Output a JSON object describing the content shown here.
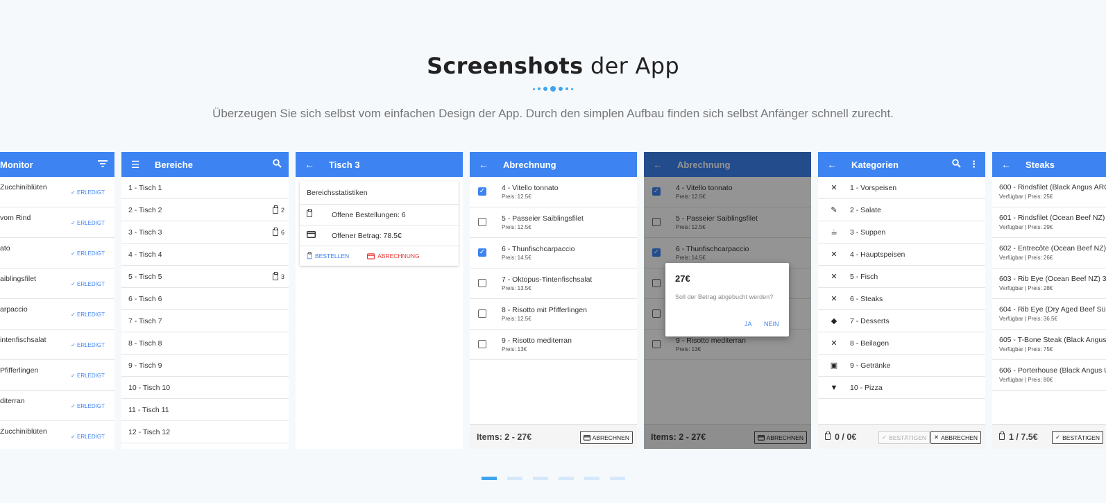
{
  "header": {
    "title_bold": "Screenshots",
    "title_light": " der App",
    "subtitle": "Überzeugen Sie sich selbst vom einfachen Design der App. Durch den simplen Aufbau finden sich selbst Anfänger schnell zurecht."
  },
  "colors": {
    "accent": "#3d84f2",
    "brand_blue": "#3fa5f0",
    "danger": "#e53935"
  },
  "screens": {
    "monitor": {
      "title": "Monitor",
      "action_icon": "filter-icon",
      "items": [
        {
          "name": "Zucchiniblüten",
          "status": "ERLEDIGT"
        },
        {
          "name": "vom Rind",
          "status": "ERLEDIGT"
        },
        {
          "name": "ato",
          "status": "ERLEDIGT"
        },
        {
          "name": "aiblingsfilet",
          "status": "ERLEDIGT"
        },
        {
          "name": "arpaccio",
          "status": "ERLEDIGT"
        },
        {
          "name": "intenfischsalat",
          "status": "ERLEDIGT"
        },
        {
          "name": "Pfifferlingen",
          "status": "ERLEDIGT"
        },
        {
          "name": "diterran",
          "status": "ERLEDIGT"
        },
        {
          "name": "Zucchiniblüten",
          "status": "ERLEDIGT"
        }
      ]
    },
    "bereiche": {
      "title": "Bereiche",
      "menu_icon": "menu-icon",
      "search_icon": "search-icon",
      "tables": [
        {
          "label": "1 - Tisch 1",
          "count": ""
        },
        {
          "label": "2 - Tisch 2",
          "count": "2"
        },
        {
          "label": "3 - Tisch 3",
          "count": "6"
        },
        {
          "label": "4 - Tisch 4",
          "count": ""
        },
        {
          "label": "5 - Tisch 5",
          "count": "3"
        },
        {
          "label": "6 - Tisch 6",
          "count": ""
        },
        {
          "label": "7 - Tisch 7",
          "count": ""
        },
        {
          "label": "8 - Tisch 8",
          "count": ""
        },
        {
          "label": "9 - Tisch 9",
          "count": ""
        },
        {
          "label": "10 - Tisch 10",
          "count": ""
        },
        {
          "label": "11 - Tisch 11",
          "count": ""
        },
        {
          "label": "12 - Tisch 12",
          "count": ""
        }
      ]
    },
    "tisch3": {
      "title": "Tisch 3",
      "stats_heading": "Bereichsstatistiken",
      "open_orders": "Offene Bestellungen: 6",
      "open_amount": "Offener Betrag: 78.5€",
      "order_button": "BESTELLEN",
      "billing_button": "ABRECHNUNG"
    },
    "abrechnung": {
      "title": "Abrechnung",
      "items": [
        {
          "name": "4 - Vitello tonnato",
          "price": "Preis: 12.5€",
          "checked": true
        },
        {
          "name": "5 - Passeier Saiblingsfilet",
          "price": "Preis: 12.5€",
          "checked": false
        },
        {
          "name": "6 - Thunfischcarpaccio",
          "price": "Preis: 14.5€",
          "checked": true
        },
        {
          "name": "7 - Oktopus-Tintenfischsalat",
          "price": "Preis: 13.5€",
          "checked": false
        },
        {
          "name": "8 - Risotto mit Pfifferlingen",
          "price": "Preis: 12.5€",
          "checked": false
        },
        {
          "name": "9 - Risotto mediterran",
          "price": "Preis: 13€",
          "checked": false
        }
      ],
      "footer_total": "Items: 2 - 27€",
      "footer_button": "ABRECHNEN"
    },
    "abrechnung_dialog": {
      "title": "Abrechnung",
      "dialog_amount": "27€",
      "dialog_question": "Soll der Betrag abgebucht werden?",
      "dialog_yes": "JA",
      "dialog_no": "NEIN",
      "footer_total": "Items: 2 - 27€",
      "footer_button": "ABRECHNEN"
    },
    "kategorien": {
      "title": "Kategorien",
      "items": [
        {
          "label": "1 - Vorspeisen",
          "icon": "cutlery-icon"
        },
        {
          "label": "2 - Salate",
          "icon": "carrot-icon"
        },
        {
          "label": "3 - Suppen",
          "icon": "soup-icon"
        },
        {
          "label": "4 - Hauptspeisen",
          "icon": "cutlery-icon"
        },
        {
          "label": "5 - Fisch",
          "icon": "cutlery-icon"
        },
        {
          "label": "6 - Steaks",
          "icon": "cutlery-icon"
        },
        {
          "label": "7 - Desserts",
          "icon": "ice-cream-icon"
        },
        {
          "label": "8 - Beilagen",
          "icon": "cutlery-icon"
        },
        {
          "label": "9 - Getränke",
          "icon": "beer-icon"
        },
        {
          "label": "10 - Pizza",
          "icon": "pizza-icon"
        }
      ],
      "footer_total": "0 / 0€",
      "confirm_button": "BESTÄTIGEN",
      "cancel_button": "ABBRECHEN"
    },
    "steaks": {
      "title": "Steaks",
      "items": [
        {
          "name": "600 - Rindsfilet (Black Angus ARG",
          "detail": "Verfügbar | Preis: 25€"
        },
        {
          "name": "601 - Rindsfilet (Ocean Beef NZ)",
          "detail": "Verfügbar | Preis: 29€"
        },
        {
          "name": "602 - Entrecôte (Ocean Beef NZ) 3",
          "detail": "Verfügbar | Preis: 26€"
        },
        {
          "name": "603 - Rib Eye (Ocean Beef NZ) 300",
          "detail": "Verfügbar | Preis: 28€"
        },
        {
          "name": "604 - Rib Eye (Dry Aged Beef Südt",
          "detail": "Verfügbar | Preis: 36.5€"
        },
        {
          "name": "605 - T-Bone Steak (Black Angus U",
          "detail": "Verfügbar | Preis: 75€"
        },
        {
          "name": "606 - Porterhouse (Black Angus U",
          "detail": "Verfügbar | Preis: 80€"
        }
      ],
      "footer_total": "1 / 7.5€",
      "confirm_button": "BESTÄTIGEN"
    }
  },
  "carousel": {
    "page_count": 6,
    "active_page": 1
  }
}
